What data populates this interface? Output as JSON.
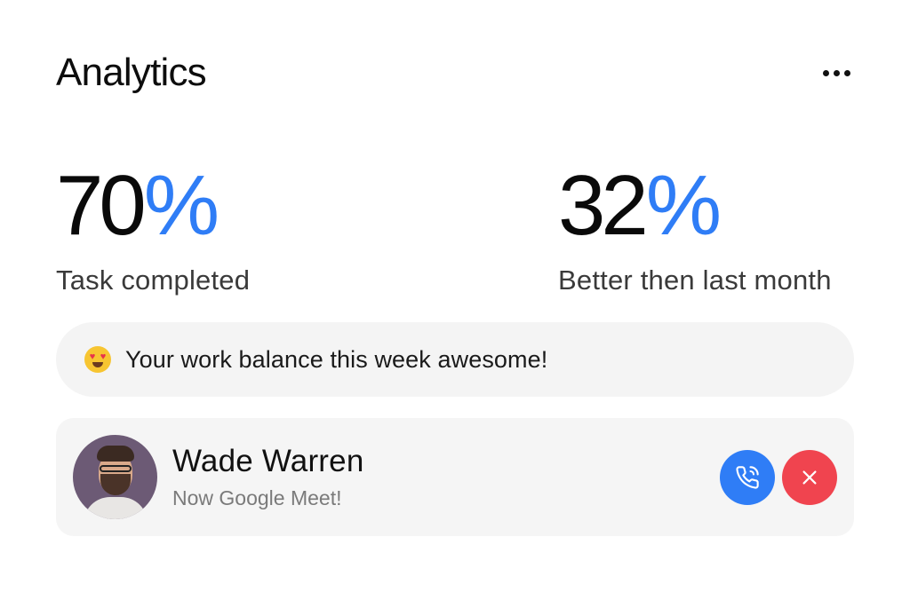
{
  "header": {
    "title": "Analytics",
    "more_icon": "more-horizontal-icon"
  },
  "stats": [
    {
      "number": "70",
      "unit": "%",
      "label": "Task completed"
    },
    {
      "number": "32",
      "unit": "%",
      "label": "Better then last month"
    }
  ],
  "banner": {
    "emoji": "heart-eyes-emoji",
    "text": "Your work balance this week awesome!"
  },
  "contact": {
    "name": "Wade Warren",
    "subtitle": "Now Google Meet!",
    "call_icon": "phone-call-icon",
    "decline_icon": "close-icon"
  },
  "colors": {
    "accent": "#2f7df6",
    "decline": "#f0444f",
    "surface": "#f4f4f4"
  }
}
